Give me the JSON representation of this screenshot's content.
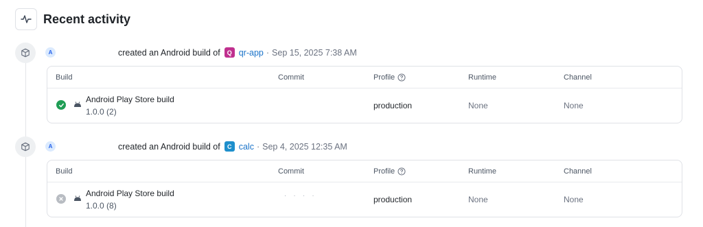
{
  "header": {
    "title": "Recent activity",
    "icon": "activity-icon"
  },
  "activities": [
    {
      "avatar_initial": "A",
      "action": "created an Android build of",
      "app_initial": "Q",
      "app_color": "#c0308f",
      "app_name": "qr-app",
      "separator": "·",
      "timestamp": "Sep 15, 2025 7:38 AM",
      "columns": [
        "Build",
        "Commit",
        "Profile",
        "Runtime",
        "Channel"
      ],
      "build": {
        "status": "success",
        "status_color": "#1f9d55",
        "name": "Android Play Store build",
        "version": "1.0.0 (2)",
        "commit": "",
        "profile": "production",
        "runtime": "None",
        "channel": "None"
      }
    },
    {
      "avatar_initial": "A",
      "action": "created an Android build of",
      "app_initial": "C",
      "app_color": "#1e8fcc",
      "app_name": "calc",
      "separator": "·",
      "timestamp": "Sep 4, 2025 12:35 AM",
      "columns": [
        "Build",
        "Commit",
        "Profile",
        "Runtime",
        "Channel"
      ],
      "build": {
        "status": "canceled",
        "status_color": "#b8bcc2",
        "name": "Android Play Store build",
        "version": "1.0.0 (8)",
        "commit": "· · · ·",
        "profile": "production",
        "runtime": "None",
        "channel": "None"
      }
    }
  ]
}
